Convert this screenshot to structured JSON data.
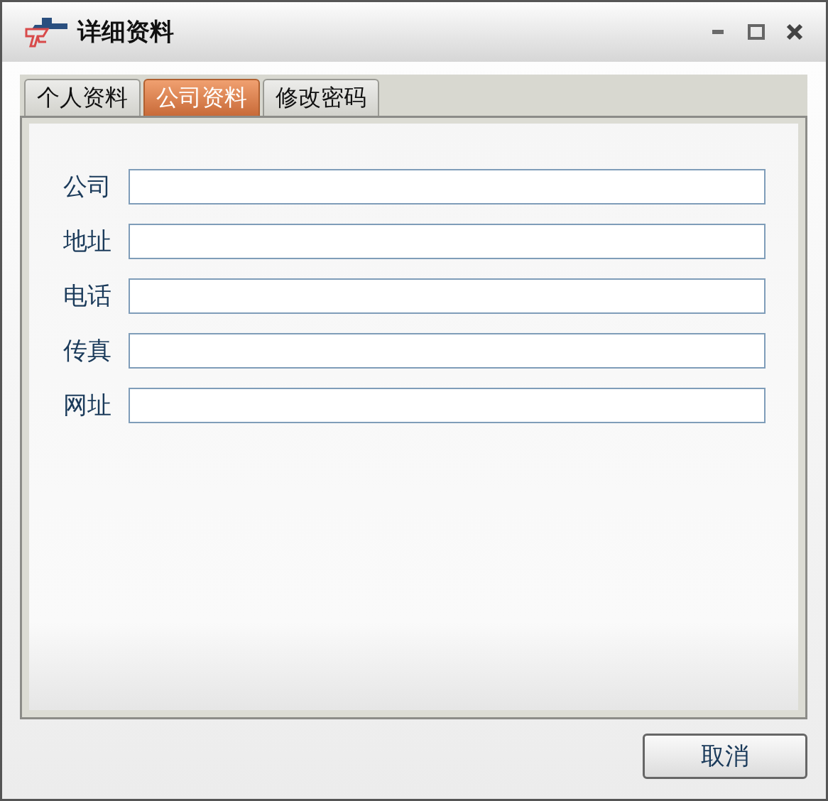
{
  "window": {
    "title": "详细资料"
  },
  "tabs": [
    {
      "label": "个人资料",
      "selected": false
    },
    {
      "label": "公司资料",
      "selected": true
    },
    {
      "label": "修改密码",
      "selected": false
    }
  ],
  "fields": [
    {
      "label": "公司"
    },
    {
      "label": "地址"
    },
    {
      "label": "电话"
    },
    {
      "label": "传真"
    },
    {
      "label": "网址"
    }
  ],
  "buttons": [
    "取消"
  ]
}
